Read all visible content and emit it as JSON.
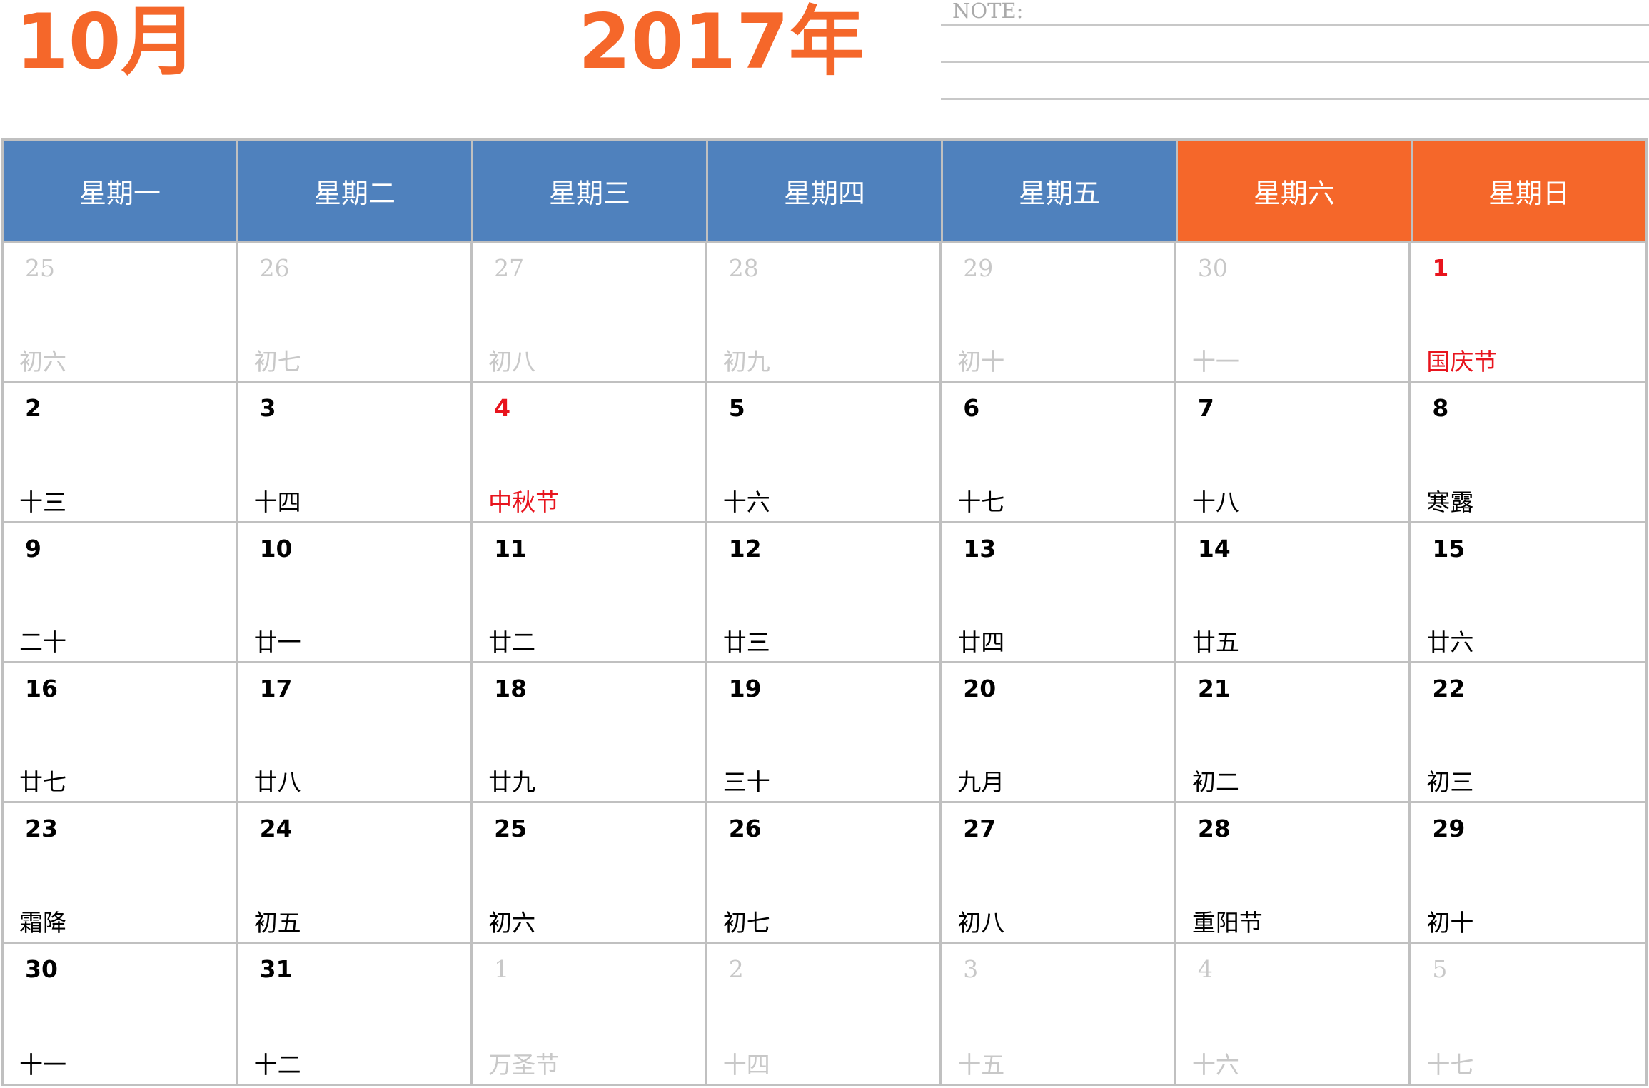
{
  "header": {
    "month": "10月",
    "year": "2017年",
    "note_label": "NOTE:"
  },
  "colors": {
    "accent_orange": "#f5672a",
    "weekday_blue": "#4f81bd",
    "holiday_red": "#e8141d",
    "muted_gray": "#c8c8c8"
  },
  "weekdays": [
    {
      "label": "星期一",
      "weekend": false
    },
    {
      "label": "星期二",
      "weekend": false
    },
    {
      "label": "星期三",
      "weekend": false
    },
    {
      "label": "星期四",
      "weekend": false
    },
    {
      "label": "星期五",
      "weekend": false
    },
    {
      "label": "星期六",
      "weekend": true
    },
    {
      "label": "星期日",
      "weekend": true
    }
  ],
  "days": [
    {
      "num": "25",
      "lunar": "初六",
      "other": true,
      "holiday": false
    },
    {
      "num": "26",
      "lunar": "初七",
      "other": true,
      "holiday": false
    },
    {
      "num": "27",
      "lunar": "初八",
      "other": true,
      "holiday": false
    },
    {
      "num": "28",
      "lunar": "初九",
      "other": true,
      "holiday": false
    },
    {
      "num": "29",
      "lunar": "初十",
      "other": true,
      "holiday": false
    },
    {
      "num": "30",
      "lunar": "十一",
      "other": true,
      "holiday": false
    },
    {
      "num": "1",
      "lunar": "国庆节",
      "other": false,
      "holiday": true
    },
    {
      "num": "2",
      "lunar": "十三",
      "other": false,
      "holiday": false
    },
    {
      "num": "3",
      "lunar": "十四",
      "other": false,
      "holiday": false
    },
    {
      "num": "4",
      "lunar": "中秋节",
      "other": false,
      "holiday": true
    },
    {
      "num": "5",
      "lunar": "十六",
      "other": false,
      "holiday": false
    },
    {
      "num": "6",
      "lunar": "十七",
      "other": false,
      "holiday": false
    },
    {
      "num": "7",
      "lunar": "十八",
      "other": false,
      "holiday": false
    },
    {
      "num": "8",
      "lunar": "寒露",
      "other": false,
      "holiday": false
    },
    {
      "num": "9",
      "lunar": "二十",
      "other": false,
      "holiday": false
    },
    {
      "num": "10",
      "lunar": "廿一",
      "other": false,
      "holiday": false
    },
    {
      "num": "11",
      "lunar": "廿二",
      "other": false,
      "holiday": false
    },
    {
      "num": "12",
      "lunar": "廿三",
      "other": false,
      "holiday": false
    },
    {
      "num": "13",
      "lunar": "廿四",
      "other": false,
      "holiday": false
    },
    {
      "num": "14",
      "lunar": "廿五",
      "other": false,
      "holiday": false
    },
    {
      "num": "15",
      "lunar": "廿六",
      "other": false,
      "holiday": false
    },
    {
      "num": "16",
      "lunar": "廿七",
      "other": false,
      "holiday": false
    },
    {
      "num": "17",
      "lunar": "廿八",
      "other": false,
      "holiday": false
    },
    {
      "num": "18",
      "lunar": "廿九",
      "other": false,
      "holiday": false
    },
    {
      "num": "19",
      "lunar": "三十",
      "other": false,
      "holiday": false
    },
    {
      "num": "20",
      "lunar": "九月",
      "other": false,
      "holiday": false
    },
    {
      "num": "21",
      "lunar": "初二",
      "other": false,
      "holiday": false
    },
    {
      "num": "22",
      "lunar": "初三",
      "other": false,
      "holiday": false
    },
    {
      "num": "23",
      "lunar": "霜降",
      "other": false,
      "holiday": false
    },
    {
      "num": "24",
      "lunar": "初五",
      "other": false,
      "holiday": false
    },
    {
      "num": "25",
      "lunar": "初六",
      "other": false,
      "holiday": false
    },
    {
      "num": "26",
      "lunar": "初七",
      "other": false,
      "holiday": false
    },
    {
      "num": "27",
      "lunar": "初八",
      "other": false,
      "holiday": false
    },
    {
      "num": "28",
      "lunar": "重阳节",
      "other": false,
      "holiday": false
    },
    {
      "num": "29",
      "lunar": "初十",
      "other": false,
      "holiday": false
    },
    {
      "num": "30",
      "lunar": "十一",
      "other": false,
      "holiday": false
    },
    {
      "num": "31",
      "lunar": "十二",
      "other": false,
      "holiday": false
    },
    {
      "num": "1",
      "lunar": "万圣节",
      "other": true,
      "holiday": false
    },
    {
      "num": "2",
      "lunar": "十四",
      "other": true,
      "holiday": false
    },
    {
      "num": "3",
      "lunar": "十五",
      "other": true,
      "holiday": false
    },
    {
      "num": "4",
      "lunar": "十六",
      "other": true,
      "holiday": false
    },
    {
      "num": "5",
      "lunar": "十七",
      "other": true,
      "holiday": false
    }
  ]
}
